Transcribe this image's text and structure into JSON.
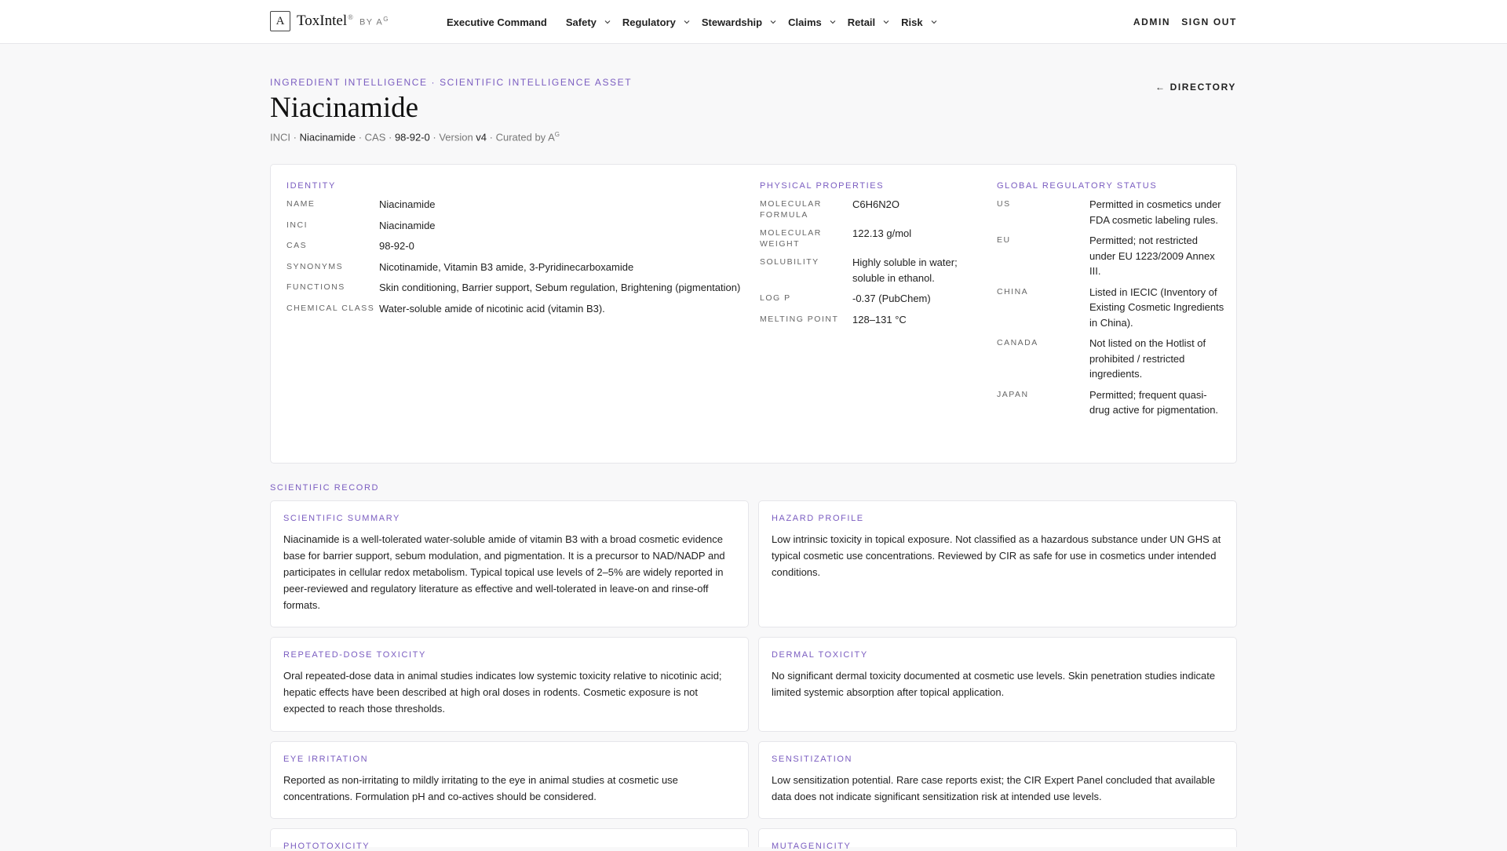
{
  "brand": {
    "mark": "A",
    "name": "ToxIntel",
    "reg": "®",
    "by": "BY A",
    "by_sup": "G"
  },
  "nav": {
    "items": [
      {
        "label": "Executive Command",
        "dropdown": false
      },
      {
        "label": "Safety",
        "dropdown": true
      },
      {
        "label": "Regulatory",
        "dropdown": true
      },
      {
        "label": "Stewardship",
        "dropdown": true
      },
      {
        "label": "Claims",
        "dropdown": true
      },
      {
        "label": "Retail",
        "dropdown": true
      },
      {
        "label": "Risk",
        "dropdown": true
      }
    ],
    "admin": "ADMIN",
    "signout": "SIGN OUT"
  },
  "header": {
    "eyebrow": "INGREDIENT INTELLIGENCE · SCIENTIFIC INTELLIGENCE ASSET",
    "directory": "← DIRECTORY",
    "title": "Niacinamide",
    "meta": {
      "inci_label": "INCI · ",
      "inci": "Niacinamide",
      "cas_label": " · CAS · ",
      "cas": "98-92-0",
      "version_label": " · Version ",
      "version": "v4",
      "curated": " · Curated by A",
      "curated_sup": "G"
    }
  },
  "identity": {
    "heading": "IDENTITY",
    "rows": [
      {
        "key": "NAME",
        "value": "Niacinamide"
      },
      {
        "key": "INCI",
        "value": "Niacinamide"
      },
      {
        "key": "CAS",
        "value": "98-92-0"
      },
      {
        "key": "SYNONYMS",
        "value": "Nicotinamide, Vitamin B3 amide, 3-Pyridinecarboxamide"
      },
      {
        "key": "FUNCTIONS",
        "value": "Skin conditioning, Barrier support, Sebum regulation, Brightening (pigmentation)"
      },
      {
        "key": "CHEMICAL CLASS",
        "value": "Water-soluble amide of nicotinic acid (vitamin B3)."
      }
    ]
  },
  "physical": {
    "heading": "PHYSICAL PROPERTIES",
    "rows": [
      {
        "key": "MOLECULAR FORMULA",
        "value": "C6H6N2O"
      },
      {
        "key": "MOLECULAR WEIGHT",
        "value": "122.13 g/mol"
      },
      {
        "key": "SOLUBILITY",
        "value": "Highly soluble in water; soluble in ethanol."
      },
      {
        "key": "LOG P",
        "value": "-0.37 (PubChem)"
      },
      {
        "key": "MELTING POINT",
        "value": "128–131 °C"
      }
    ]
  },
  "regulatory": {
    "heading": "GLOBAL REGULATORY STATUS",
    "rows": [
      {
        "key": "US",
        "value": "Permitted in cosmetics under FDA cosmetic labeling rules."
      },
      {
        "key": "EU",
        "value": "Permitted; not restricted under EU 1223/2009 Annex III."
      },
      {
        "key": "CHINA",
        "value": "Listed in IECIC (Inventory of Existing Cosmetic Ingredients in China)."
      },
      {
        "key": "CANADA",
        "value": "Not listed on the Hotlist of prohibited / restricted ingredients."
      },
      {
        "key": "JAPAN",
        "value": "Permitted; frequent quasi-drug active for pigmentation."
      }
    ]
  },
  "record": {
    "heading": "SCIENTIFIC RECORD",
    "cards": [
      {
        "title": "SCIENTIFIC SUMMARY",
        "body": "Niacinamide is a well-tolerated water-soluble amide of vitamin B3 with a broad cosmetic evidence base for barrier support, sebum modulation, and pigmentation. It is a precursor to NAD/NADP and participates in cellular redox metabolism. Typical topical use levels of 2–5% are widely reported in peer-reviewed and regulatory literature as effective and well-tolerated in leave-on and rinse-off formats."
      },
      {
        "title": "HAZARD PROFILE",
        "body": "Low intrinsic toxicity in topical exposure. Not classified as a hazardous substance under UN GHS at typical cosmetic use concentrations. Reviewed by CIR as safe for use in cosmetics under intended conditions."
      },
      {
        "title": "REPEATED-DOSE TOXICITY",
        "body": "Oral repeated-dose data in animal studies indicates low systemic toxicity relative to nicotinic acid; hepatic effects have been described at high oral doses in rodents. Cosmetic exposure is not expected to reach those thresholds."
      },
      {
        "title": "DERMAL TOXICITY",
        "body": "No significant dermal toxicity documented at cosmetic use levels. Skin penetration studies indicate limited systemic absorption after topical application."
      },
      {
        "title": "EYE IRRITATION",
        "body": "Reported as non-irritating to mildly irritating to the eye in animal studies at cosmetic use concentrations. Formulation pH and co-actives should be considered."
      },
      {
        "title": "SENSITIZATION",
        "body": "Low sensitization potential. Rare case reports exist; the CIR Expert Panel concluded that available data does not indicate significant sensitization risk at intended use levels."
      },
      {
        "title": "PHOTOTOXICITY",
        "body": ""
      },
      {
        "title": "MUTAGENICITY",
        "body": ""
      }
    ]
  }
}
